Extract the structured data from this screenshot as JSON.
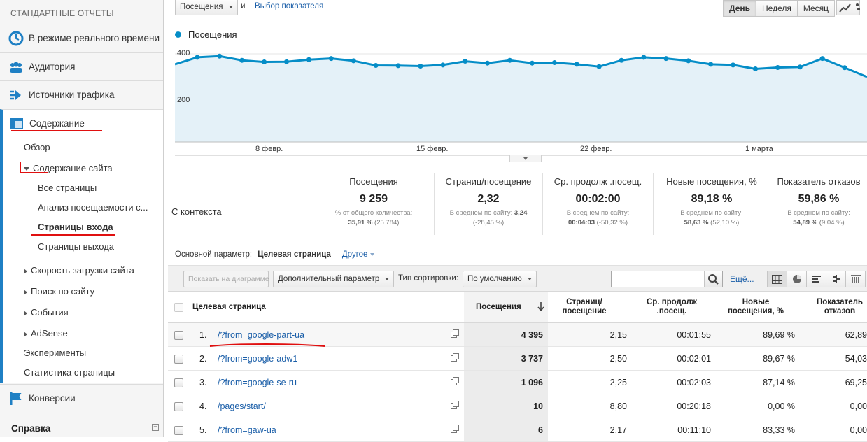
{
  "sidebar": {
    "header": "СТАНДАРТНЫЕ ОТЧЕТЫ",
    "sections": [
      {
        "label": "В режиме реального времени",
        "icon": "clock-icon"
      },
      {
        "label": "Аудитория",
        "icon": "people-icon"
      },
      {
        "label": "Источники трафика",
        "icon": "traffic-icon"
      },
      {
        "label": "Содержание",
        "icon": "content-icon"
      },
      {
        "label": "Конверсии",
        "icon": "flag-icon"
      }
    ],
    "content_items": [
      {
        "label": "Обзор"
      },
      {
        "label": "Содержание сайта"
      },
      {
        "label": "Все страницы"
      },
      {
        "label": "Анализ посещаемости с..."
      },
      {
        "label": "Страницы входа"
      },
      {
        "label": "Страницы выхода"
      },
      {
        "label": "Скорость загрузки сайта"
      },
      {
        "label": "Поиск по сайту"
      },
      {
        "label": "События"
      },
      {
        "label": "AdSense"
      },
      {
        "label": "Эксперименты"
      },
      {
        "label": "Статистика страницы"
      }
    ],
    "help": "Справка"
  },
  "controls": {
    "metric_select": "Посещения",
    "and_label": "и",
    "choose_metric": "Выбор показателя",
    "periods": [
      "День",
      "Неделя",
      "Месяц"
    ],
    "selected_period": "День"
  },
  "chart_data": {
    "type": "area",
    "series": [
      {
        "name": "Посещения",
        "values": [
          355,
          385,
          390,
          372,
          365,
          366,
          375,
          380,
          370,
          350,
          349,
          347,
          352,
          368,
          360,
          372,
          360,
          362,
          355,
          345,
          372,
          385,
          380,
          370,
          355,
          352,
          335,
          341,
          343,
          380,
          340,
          300
        ]
      }
    ],
    "x_ticks": [
      "8 февр.",
      "15 февр.",
      "22 февр.",
      "1 марта"
    ],
    "y_ticks": [
      "400",
      "200"
    ],
    "color": "#058dc7",
    "fill": "#e4f1f8"
  },
  "scorecards": {
    "segment": "С контекста",
    "cards": [
      {
        "title": "Посещения",
        "value": "9 259",
        "sub1": "% от общего количества:",
        "sub2_bold": "35,91 %",
        "sub2_rest": " (25 784)"
      },
      {
        "title": "Страниц/посещение",
        "value": "2,32",
        "sub1_pre": "В среднем по сайту: ",
        "sub1_bold": "3,24",
        "sub2_bold": "",
        "sub2_rest": "(-28,45 %)"
      },
      {
        "title": "Ср. продолж .посещ.",
        "value": "00:02:00",
        "sub1": "В среднем по сайту:",
        "sub2_bold": "00:04:03",
        "sub2_rest": " (-50,32 %)"
      },
      {
        "title": "Новые посещения, %",
        "value": "89,18 %",
        "sub1": "В среднем по сайту:",
        "sub2_bold": "58,63 %",
        "sub2_rest": " (52,10 %)"
      },
      {
        "title": "Показатель отказов",
        "value": "59,86 %",
        "sub1": "В среднем по сайту:",
        "sub2_bold": "54,89 %",
        "sub2_rest": " (9,04 %)"
      }
    ]
  },
  "dimension": {
    "label": "Основной параметр:",
    "current": "Целевая страница",
    "other": "Другое"
  },
  "toolbar": {
    "plot_rows": "Показать на диаграмме",
    "secondary_dim": "Дополнительный параметр",
    "sort_label": "Тип сортировки:",
    "sort_value": "По умолчанию",
    "search_value": "",
    "advanced": "Ещё..."
  },
  "table": {
    "headers": {
      "page": "Целевая страница",
      "visits": "Посещения",
      "pages_per_visit_1": "Страниц/",
      "pages_per_visit_2": "посещение",
      "avg_dur_1": "Ср. продолж",
      "avg_dur_2": ".посещ.",
      "new_1": "Новые",
      "new_2": "посещения, %",
      "bounce_1": "Показатель",
      "bounce_2": "отказов"
    },
    "rows": [
      {
        "n": "1.",
        "page": "/?from=google-part-ua",
        "visits": "4 395",
        "ppv": "2,15",
        "dur": "00:01:55",
        "new": "89,69 %",
        "bounce": "62,89"
      },
      {
        "n": "2.",
        "page": "/?from=google-adw1",
        "visits": "3 737",
        "ppv": "2,50",
        "dur": "00:02:01",
        "new": "89,67 %",
        "bounce": "54,03"
      },
      {
        "n": "3.",
        "page": "/?from=google-se-ru",
        "visits": "1 096",
        "ppv": "2,25",
        "dur": "00:02:03",
        "new": "87,14 %",
        "bounce": "69,25"
      },
      {
        "n": "4.",
        "page": "/pages/start/",
        "visits": "10",
        "ppv": "8,80",
        "dur": "00:20:18",
        "new": "0,00 %",
        "bounce": "0,00"
      },
      {
        "n": "5.",
        "page": "/?from=gaw-ua",
        "visits": "6",
        "ppv": "2,17",
        "dur": "00:11:10",
        "new": "83,33 %",
        "bounce": "0,00"
      }
    ]
  }
}
